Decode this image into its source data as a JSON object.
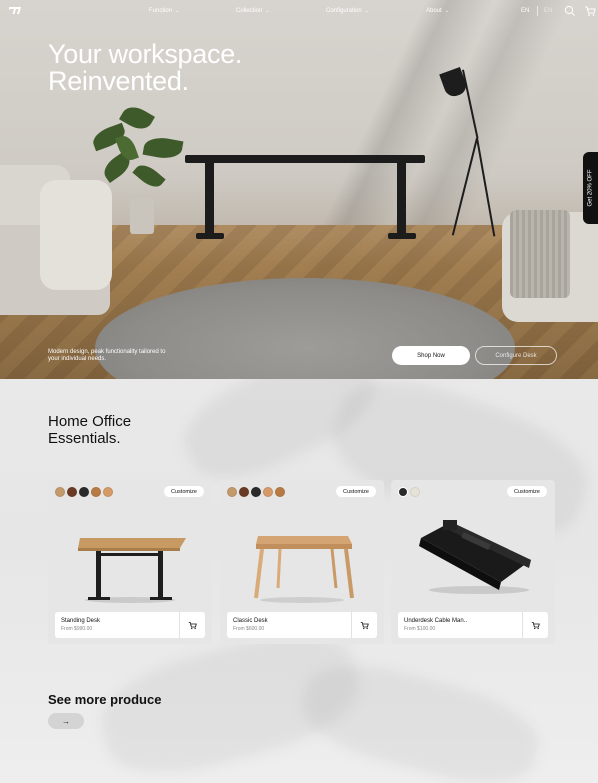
{
  "nav": {
    "items": [
      {
        "label": "Function"
      },
      {
        "label": "Collection"
      },
      {
        "label": "Configuration"
      },
      {
        "label": "About"
      }
    ],
    "lang_active": "EN",
    "lang_other": "ΕΝ",
    "icons": [
      "logo-icon",
      "search-icon",
      "cart-icon"
    ]
  },
  "hero": {
    "title_line1": "Your workspace.",
    "title_line2": "Reinvented.",
    "subtitle": "Modern design, peak functionality tailored to your individual needs.",
    "shop_button": "Shop Now",
    "configure_button": "Configure Desk"
  },
  "side_tab": {
    "label": "Get 20% OFF"
  },
  "essentials": {
    "title": "Home Office\nEssentials.",
    "products": [
      {
        "name": "Standing Desk",
        "price": "From $990.00",
        "customize": "Customize",
        "swatches": [
          "#c39a6b",
          "#6a3b24",
          "#2a2a2a",
          "#b87a43",
          "#d69a68"
        ]
      },
      {
        "name": "Classic Desk",
        "price": "From $600.00",
        "customize": "Customize",
        "swatches": [
          "#c39a6b",
          "#6a3b24",
          "#2a2a2a",
          "#d69a68",
          "#b87a43"
        ]
      },
      {
        "name": "Underdesk Cable Man..",
        "price": "From $100.00",
        "customize": "Customize",
        "swatches": [
          "#2a2a2a",
          "#e6e2d4"
        ]
      }
    ]
  },
  "more": {
    "title": "See more produce",
    "arrow": "→"
  },
  "colors": {
    "accent_dark": "#111111",
    "card_bg": "#e6e6e6"
  }
}
